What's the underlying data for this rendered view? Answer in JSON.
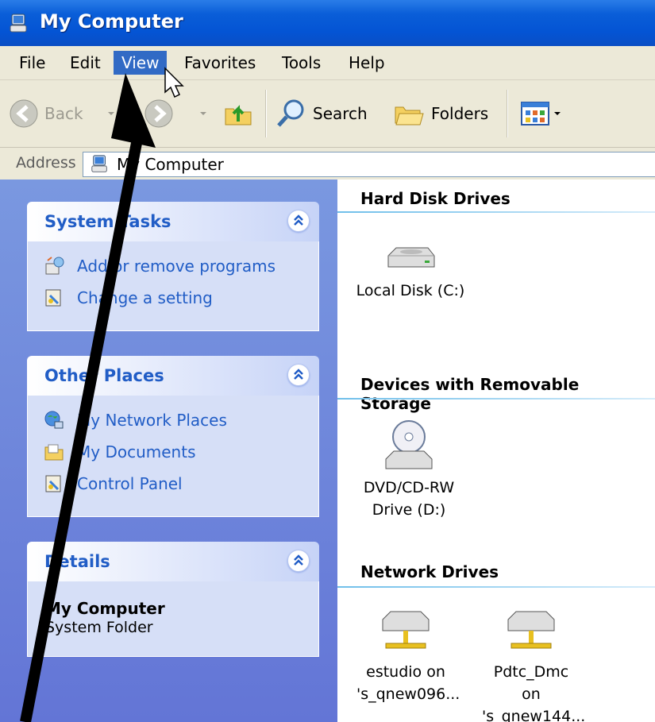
{
  "window": {
    "title": "My Computer"
  },
  "menubar": {
    "items": [
      "File",
      "Edit",
      "View",
      "Favorites",
      "Tools",
      "Help"
    ],
    "active": "View"
  },
  "toolbar": {
    "back_label": "Back",
    "search_label": "Search",
    "folders_label": "Folders"
  },
  "address": {
    "label": "Address",
    "value": "My Computer"
  },
  "sidebar": {
    "system_tasks": {
      "title": "System Tasks",
      "items": [
        "Add or remove programs",
        "Change a setting"
      ]
    },
    "other_places": {
      "title": "Other Places",
      "items": [
        "My Network Places",
        "My Documents",
        "Control Panel"
      ]
    },
    "details": {
      "title": "Details",
      "name": "My Computer",
      "type": "System Folder"
    }
  },
  "content": {
    "groups": [
      {
        "title": "Hard Disk Drives",
        "items": [
          {
            "line1": "Local Disk (C:)"
          }
        ]
      },
      {
        "title": "Devices with Removable Storage",
        "items": [
          {
            "line1": "DVD/CD-RW",
            "line2": "Drive (D:)"
          }
        ]
      },
      {
        "title": "Network Drives",
        "items": [
          {
            "line1": "estudio on",
            "line2": "'s_qnew096..."
          },
          {
            "line1": "Pdtc_Dmc on",
            "line2": "'s_qnew144..."
          }
        ]
      }
    ]
  },
  "colors": {
    "title_bar": "#0454d4",
    "menu_highlight": "#316ac5",
    "sidebar_bg": "#6375d6",
    "link_text": "#215dc6"
  }
}
